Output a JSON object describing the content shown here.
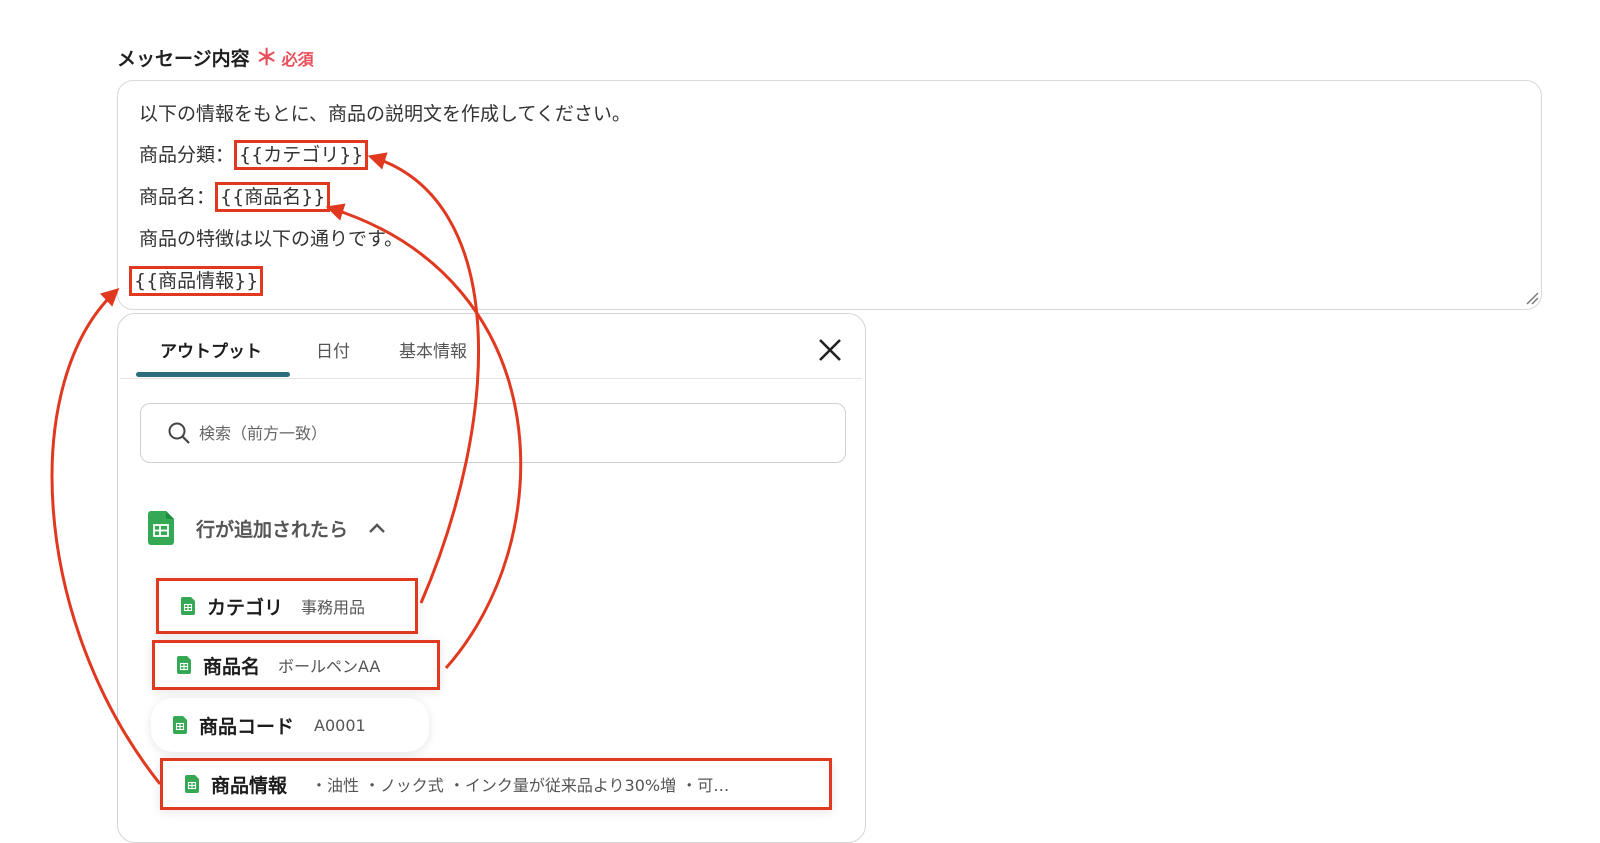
{
  "field": {
    "label": "メッセージ内容",
    "required_mark": "＊",
    "required_text": "必須"
  },
  "message": {
    "lines": [
      "以下の情報をもとに、商品の説明文を作成してください。",
      "商品分類：",
      "商品名：",
      "商品の特徴は以下の通りです。"
    ],
    "var_category": "{{カテゴリ}}",
    "var_name": "{{商品名}}",
    "var_info": "{{商品情報}}"
  },
  "panel": {
    "tabs": [
      {
        "label": "アウトプット",
        "active": true
      },
      {
        "label": "日付",
        "active": false
      },
      {
        "label": "基本情報",
        "active": false
      }
    ],
    "search_placeholder": "検索（前方一致）",
    "group": {
      "label": "行が追加されたら",
      "items": [
        {
          "label": "カテゴリ",
          "value": "事務用品",
          "highlighted": true
        },
        {
          "label": "商品名",
          "value": "ボールペンAA",
          "highlighted": true
        },
        {
          "label": "商品コード",
          "value": "A0001",
          "highlighted": false
        },
        {
          "label": "商品情報",
          "value": "・油性 ・ノック式 ・インク量が従来品より30%増 ・可…",
          "highlighted": true
        }
      ]
    }
  },
  "colors": {
    "highlight": "#e0391f",
    "required": "#e8505b",
    "tab_underline": "#2b6d7c",
    "sheet_icon": "#34a853"
  },
  "icons": [
    "search-icon",
    "close-icon",
    "chevron-up-icon",
    "spreadsheet-icon",
    "resize-grip-icon"
  ]
}
